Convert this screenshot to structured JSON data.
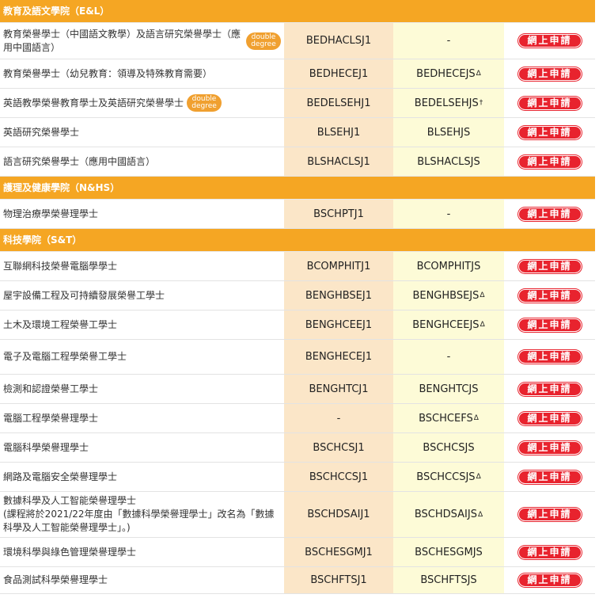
{
  "apply_label": "網上申請",
  "double_degree": [
    "double",
    "degree"
  ],
  "sections": [
    {
      "title": "教育及語文學院（E&L）",
      "rows": [
        {
          "name": "教育榮譽學士（中國語文教學）及語言研究榮譽學士（應用中國語言）",
          "code1": "BEDHACLSJ1",
          "code2": "-",
          "mark": "",
          "dd": true
        },
        {
          "name": "教育榮譽學士（幼兒教育：領導及特殊教育需要）",
          "code1": "BEDHECEJ1",
          "code2": "BEDHECEJS",
          "mark": "Δ",
          "dd": false
        },
        {
          "name": "英語教學榮譽教育學士及英語研究榮譽學士",
          "code1": "BEDELSEHJ1",
          "code2": "BEDELSEHJS",
          "mark": "†",
          "dd": true
        },
        {
          "name": "英語研究榮譽學士",
          "code1": "BLSEHJ1",
          "code2": "BLSEHJS",
          "mark": "",
          "dd": false
        },
        {
          "name": "語言研究榮譽學士（應用中國語言）",
          "code1": "BLSHACLSJ1",
          "code2": "BLSHACLSJS",
          "mark": "",
          "dd": false
        }
      ]
    },
    {
      "title": "護理及健康學院（N&HS）",
      "rows": [
        {
          "name": "物理治療學榮譽理學士",
          "code1": "BSCHPTJ1",
          "code2": "-",
          "mark": "",
          "dd": false
        }
      ]
    },
    {
      "title": "科技學院（S&T）",
      "rows": [
        {
          "name": "互聯網科技榮譽電腦學學士",
          "code1": "BCOMPHITJ1",
          "code2": "BCOMPHITJS",
          "mark": "",
          "dd": false
        },
        {
          "name": "屋宇設備工程及可持續發展榮譽工學士",
          "code1": "BENGHBSEJ1",
          "code2": "BENGHBSEJS",
          "mark": "Δ",
          "dd": false
        },
        {
          "name": "土木及環境工程榮譽工學士",
          "code1": "BENGHCEEJ1",
          "code2": "BENGHCEEJS",
          "mark": "Δ",
          "dd": false
        },
        {
          "name": "電子及電腦工程學榮譽工學士",
          "code1": "BENGHECEJ1",
          "code2": "-",
          "mark": "",
          "dd": false
        },
        {
          "name": "檢測和認證榮譽工學士",
          "code1": "BENGHTCJ1",
          "code2": "BENGHTCJS",
          "mark": "",
          "dd": false
        },
        {
          "name": "電腦工程學榮譽理學士",
          "code1": "-",
          "code2": "BSCHCEFS",
          "mark": "Δ",
          "dd": false
        },
        {
          "name": "電腦科學榮譽理學士",
          "code1": "BSCHCSJ1",
          "code2": "BSCHCSJS",
          "mark": "",
          "dd": false
        },
        {
          "name": "網路及電腦安全榮譽理學士",
          "code1": "BSCHCCSJ1",
          "code2": "BSCHCCSJS",
          "mark": "Δ",
          "dd": false
        },
        {
          "name": "數據科學及人工智能榮譽理學士\n(課程將於2021/22年度由「數據科學榮譽理學士」改名為「數據科學及人工智能榮譽理學士」。)",
          "code1": "BSCHDSAIJ1",
          "code2": "BSCHDSAIJS",
          "mark": "Δ",
          "dd": false
        },
        {
          "name": "環境科學與綠色管理榮譽理學士",
          "code1": "BSCHESGMJ1",
          "code2": "BSCHESGMJS",
          "mark": "",
          "dd": false
        },
        {
          "name": "食品測試科學榮譽理學士",
          "code1": "BSCHFTSJ1",
          "code2": "BSCHFTSJS",
          "mark": "",
          "dd": false
        }
      ]
    }
  ]
}
